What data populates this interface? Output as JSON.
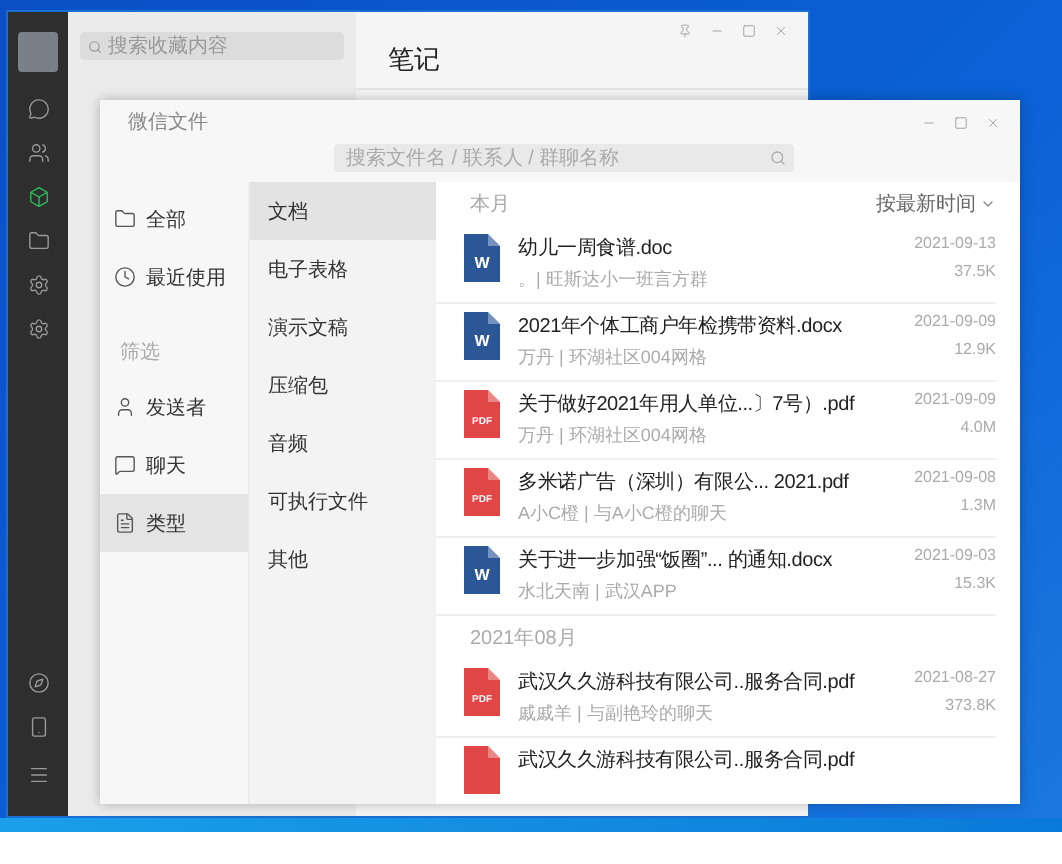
{
  "main_window": {
    "search": {
      "placeholder": "搜索收藏内容"
    },
    "title": "笔记"
  },
  "files_window": {
    "title": "微信文件",
    "search": {
      "placeholder": "搜索文件名 / 联系人 / 群聊名称"
    },
    "nav": [
      {
        "label": "全部",
        "selected": false
      },
      {
        "label": "最近使用",
        "selected": false
      }
    ],
    "filter_label": "筛选",
    "filters": [
      {
        "label": "发送者",
        "selected": false
      },
      {
        "label": "聊天",
        "selected": false
      },
      {
        "label": "类型",
        "selected": true
      }
    ],
    "types": [
      {
        "label": "文档",
        "selected": true
      },
      {
        "label": "电子表格",
        "selected": false
      },
      {
        "label": "演示文稿",
        "selected": false
      },
      {
        "label": "压缩包",
        "selected": false
      },
      {
        "label": "音频",
        "selected": false
      },
      {
        "label": "可执行文件",
        "selected": false
      },
      {
        "label": "其他",
        "selected": false
      }
    ],
    "sort": "按最新时间",
    "groups": [
      {
        "label": "本月",
        "files": [
          {
            "kind": "word",
            "badge": "W",
            "name": "幼儿一周食谱.doc",
            "meta": "。| 旺斯达小一班言方群",
            "date": "2021-09-13",
            "size": "37.5K"
          },
          {
            "kind": "word",
            "badge": "W",
            "name": "2021年个体工商户年检携带资料.docx",
            "meta": "万丹 | 环湖社区004网格",
            "date": "2021-09-09",
            "size": "12.9K"
          },
          {
            "kind": "pdf",
            "badge": "PDF",
            "name": "关于做好2021年用人单位...〕7号）.pdf",
            "meta": "万丹 | 环湖社区004网格",
            "date": "2021-09-09",
            "size": "4.0M"
          },
          {
            "kind": "pdf",
            "badge": "PDF",
            "name": "多米诺广告（深圳）有限公... 2021.pdf",
            "meta": "A小C橙 | 与A小C橙的聊天",
            "date": "2021-09-08",
            "size": "1.3M"
          },
          {
            "kind": "word",
            "badge": "W",
            "name": "关于进一步加强“饭圈”... 的通知.docx",
            "meta": "水北天南 | 武汉APP",
            "date": "2021-09-03",
            "size": "15.3K"
          }
        ]
      },
      {
        "label": "2021年08月",
        "files": [
          {
            "kind": "pdf",
            "badge": "PDF",
            "name": "武汉久久游科技有限公司..服务合同.pdf",
            "meta": "戚戚羊 | 与副艳玲的聊天",
            "date": "2021-08-27",
            "size": "373.8K"
          },
          {
            "kind": "pdf",
            "name": "武汉久久游科技有限公司..服务合同.pdf"
          }
        ]
      }
    ]
  }
}
